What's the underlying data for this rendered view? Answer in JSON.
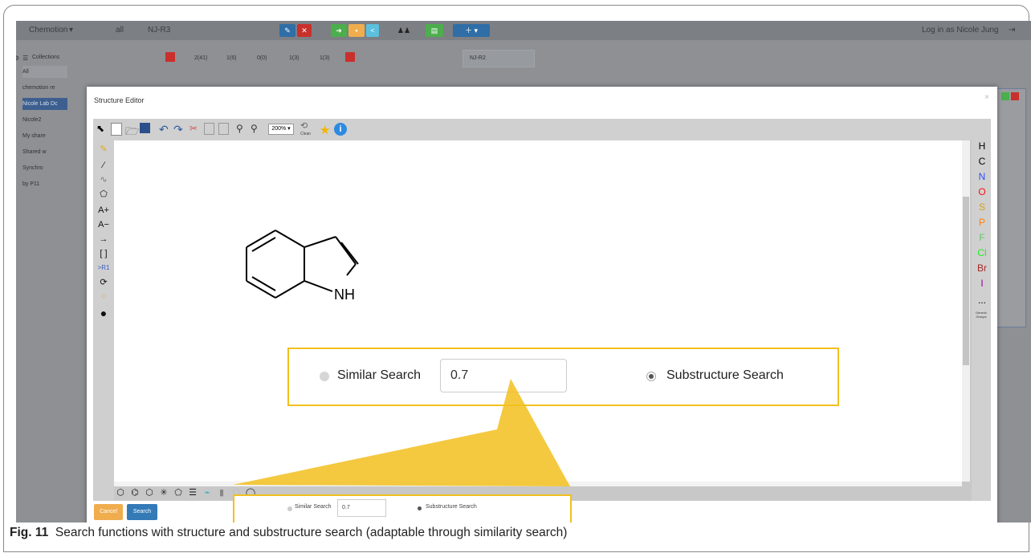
{
  "app": {
    "brand": "Chemotion",
    "nav_user": "all",
    "nav_sample": "NJ-R3",
    "nav_login": "Log in as Nicole Jung",
    "collections_label": "Collections",
    "tab_label": "NJ-R2",
    "sidebar_items": [
      "All",
      "chemotion re",
      "Nicole Lab Dc",
      "Nicole2",
      "My share",
      "Shared w",
      "Synchro",
      "by P11"
    ],
    "top_tabs": [
      "2(41)",
      "1(6)",
      "0(0)",
      "1(3)",
      "1(3)"
    ]
  },
  "modal": {
    "title": "Structure Editor",
    "close": "×"
  },
  "editor": {
    "zoom": "200%",
    "clean_label": "Clean",
    "left_tools": [
      "A+",
      "A−",
      "[ ]",
      ">R1"
    ],
    "elements": [
      {
        "symbol": "H",
        "color": "#111111"
      },
      {
        "symbol": "C",
        "color": "#111111"
      },
      {
        "symbol": "N",
        "color": "#3050f8"
      },
      {
        "symbol": "O",
        "color": "#ff0d0d"
      },
      {
        "symbol": "S",
        "color": "#d4a017"
      },
      {
        "symbol": "P",
        "color": "#ff8000"
      },
      {
        "symbol": "F",
        "color": "#5fc95f"
      },
      {
        "symbol": "Cl",
        "color": "#1ff01f"
      },
      {
        "symbol": "Br",
        "color": "#a62929"
      },
      {
        "symbol": "I",
        "color": "#940094"
      },
      {
        "symbol": "...",
        "color": "#111111"
      }
    ],
    "generic_groups": "Generic Groups",
    "nh_label": "NH"
  },
  "search_zoom": {
    "similar_label": "Similar Search",
    "threshold_value": "0.7",
    "substructure_label": "Substructure Search"
  },
  "footer": {
    "cancel_label": "Cancel",
    "search_label": "Search",
    "similar_label": "Similar Search",
    "threshold_value": "0.7",
    "substructure_label": "Substructure Search"
  },
  "caption": {
    "fig_label": "Fig. 11",
    "text": "Search functions with structure and substructure search (adaptable through similarity search)"
  },
  "colors": {
    "highlight": "#f2c01f",
    "cancel_button": "#f0ad4e",
    "search_button": "#337ab7"
  }
}
